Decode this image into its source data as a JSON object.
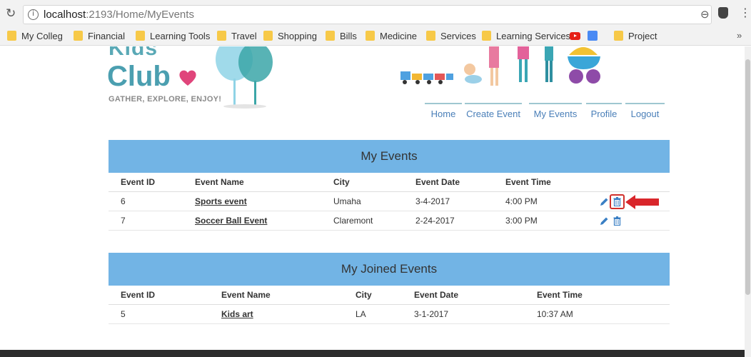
{
  "browser": {
    "url_host": "localhost",
    "url_rest": ":2193/Home/MyEvents",
    "bookmarks": [
      "My Colleg",
      "Financial",
      "Learning Tools",
      "Travel",
      "Shopping",
      "Bills",
      "Medicine",
      "Services",
      "Learning Services",
      "Project"
    ],
    "more": "»"
  },
  "site": {
    "logo_top": "Kids",
    "logo_club": "Club",
    "tagline": "GATHER, EXPLORE, ENJOY!",
    "nav": [
      "Home",
      "Create Event",
      "My Events",
      "Profile",
      "Logout"
    ],
    "accent_color": "#72b4e5"
  },
  "my_events": {
    "title": "My Events",
    "columns": [
      "Event ID",
      "Event Name",
      "City",
      "Event Date",
      "Event Time"
    ],
    "rows": [
      {
        "id": "6",
        "name": "Sports event",
        "city": "Umaha",
        "date": "3-4-2017",
        "time": "4:00 PM"
      },
      {
        "id": "7",
        "name": "Soccer Ball Event",
        "city": "Claremont",
        "date": "2-24-2017",
        "time": "3:00 PM"
      }
    ]
  },
  "joined_events": {
    "title": "My Joined Events",
    "columns": [
      "Event ID",
      "Event Name",
      "City",
      "Event Date",
      "Event Time"
    ],
    "rows": [
      {
        "id": "5",
        "name": "Kids art",
        "city": "LA",
        "date": "3-1-2017",
        "time": "10:37 AM"
      }
    ]
  },
  "icons": {
    "reload": "reload-icon",
    "info": "info-icon",
    "zoom": "zoom-icon",
    "star": "star-icon",
    "edit": "pencil-icon",
    "delete": "trash-icon",
    "annotation": "red-arrow-icon"
  }
}
